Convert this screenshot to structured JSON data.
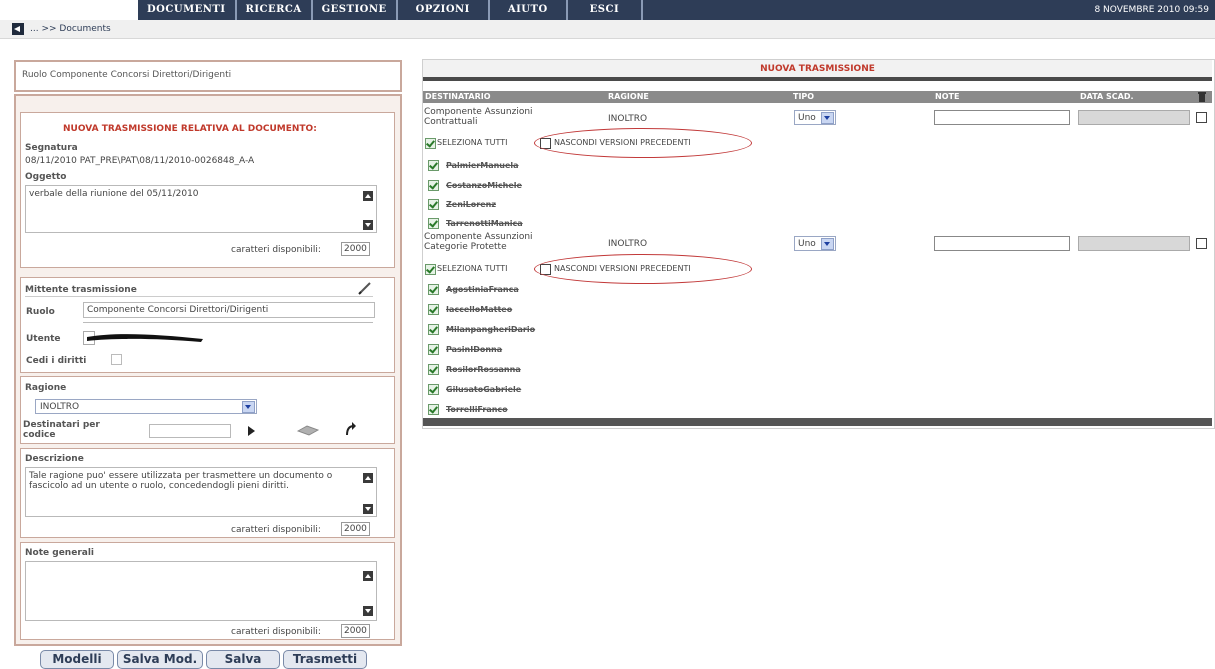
{
  "menu": [
    "DOCUMENTI",
    "RICERCA",
    "GESTIONE",
    "OPZIONI",
    "AIUTO",
    "ESCI"
  ],
  "date": "8 NOVEMBRE 2010 09:59",
  "breadcrumb": "... >> Documents",
  "left": {
    "ruolo_top": "Ruolo  Componente Concorsi Direttori/Dirigenti",
    "doc_title": "NUOVA TRASMISSIONE RELATIVA AL DOCUMENTO:",
    "segnatura_label": "Segnatura",
    "segnatura_value": "08/11/2010  PAT_PRE\\PAT\\08/11/2010-0026848_A-A",
    "oggetto_label": "Oggetto",
    "oggetto_value": "verbale della riunione del 05/11/2010",
    "chars_label": "caratteri disponibili:",
    "chars_oggetto": "2000",
    "mittente_label": "Mittente trasmissione",
    "ruolo_label": "Ruolo",
    "ruolo_value": "Componente Concorsi Direttori/Dirigenti",
    "utente_label": "Utente",
    "cedi_label": "Cedi i diritti",
    "ragione_label": "Ragione",
    "ragione_value": "INOLTRO",
    "destinatari_label_1": "Destinatari per",
    "destinatari_label_2": "codice",
    "descrizione_label": "Descrizione",
    "descrizione_value": "Tale ragione puo' essere utilizzata per trasmettere un documento o fascicolo ad un utente o ruolo, concedendogli pieni diritti.",
    "chars_descrizione": "2000",
    "note_label": "Note generali",
    "chars_note": "2000"
  },
  "buttons": [
    "Modelli",
    "Salva Mod.",
    "Salva",
    "Trasmetti"
  ],
  "table": {
    "title": "NUOVA TRASMISSIONE",
    "headers": [
      "DESTINATARIO",
      "RAGIONE",
      "TIPO",
      "NOTE",
      "DATA SCAD."
    ],
    "groups": [
      {
        "dest_line1": "Componente Assunzioni",
        "dest_line2": "Contrattuali",
        "ragione": "INOLTRO",
        "tipo": "Uno",
        "select_all": "SELEZIONA TUTTI",
        "hide_prev": "NASCONDI VERSIONI PRECEDENTI",
        "users": [
          "PalmierManuela",
          "CostanzoMichele",
          "ZeniLorenz",
          "TarrenottiManica"
        ]
      },
      {
        "dest_line1": "Componente Assunzioni",
        "dest_line2": "Categorie Protette",
        "ragione": "INOLTRO",
        "tipo": "Uno",
        "select_all": "SELEZIONA TUTTI",
        "hide_prev": "NASCONDI VERSIONI PRECEDENTI",
        "users": [
          "AgostiniaFranca",
          "IaccelloMatteo",
          "MilanpangheriDario",
          "PasinIDonna",
          "RosilorRossanna",
          "GilusatoGabriele",
          "TorrelliFranco"
        ]
      }
    ]
  },
  "colors": {
    "menu_bg": "#2e3d57",
    "panel_border": "#c9a89c",
    "title_red": "#c0392b",
    "highlight": "#c23a3a"
  }
}
